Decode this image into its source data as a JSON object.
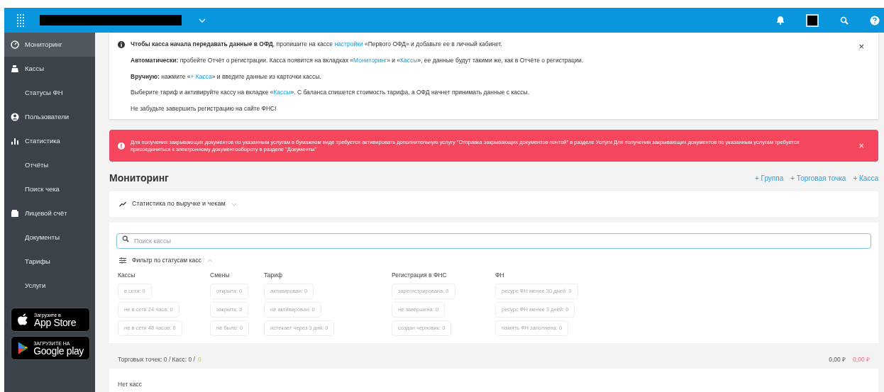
{
  "sidebar": {
    "items": [
      {
        "label": "Мониторинг",
        "kind": "gauge",
        "selected": true
      },
      {
        "label": "Кассы",
        "kind": "register",
        "selected": false
      },
      {
        "label": "Статусы ФН",
        "kind": "plain",
        "selected": false
      },
      {
        "label": "Пользователи",
        "kind": "user",
        "selected": false
      },
      {
        "label": "Статистика",
        "kind": "chart",
        "selected": false
      },
      {
        "label": "Отчёты",
        "kind": "plain",
        "selected": false
      },
      {
        "label": "Поиск чека",
        "kind": "plain",
        "selected": false
      },
      {
        "label": "Лицевой счёт",
        "kind": "wallet",
        "selected": false
      },
      {
        "label": "Документы",
        "kind": "plain",
        "selected": false
      },
      {
        "label": "Тарифы",
        "kind": "plain",
        "selected": false
      },
      {
        "label": "Услуги",
        "kind": "plain",
        "selected": false
      }
    ],
    "stores": [
      {
        "kind": "apple",
        "caption": "Загрузите в",
        "name": "App Store"
      },
      {
        "kind": "google",
        "caption": "ЗАГРУЗИТЕ НА",
        "name": "Google play"
      }
    ]
  },
  "info_notice": {
    "lines": [
      [
        {
          "kind": "bold",
          "text": "Чтобы касса начала передавать данные в ОФД"
        },
        {
          "kind": "text",
          "text": ", пропишите на кассе "
        },
        {
          "kind": "link",
          "text": "настройки"
        },
        {
          "kind": "text",
          "text": " «Первого ОФД» и добавьте ее в личный кабинет."
        }
      ],
      [
        {
          "kind": "bold",
          "text": "Автоматически:"
        },
        {
          "kind": "text",
          "text": " пробейте Отчёт о регистрации. Касса появится на вкладках «"
        },
        {
          "kind": "link",
          "text": "Мониторинг"
        },
        {
          "kind": "text",
          "text": "» и «"
        },
        {
          "kind": "link",
          "text": "Кассы"
        },
        {
          "kind": "text",
          "text": "», ее данные будут такими же, как в Отчёте о регистрации."
        }
      ],
      [
        {
          "kind": "bold",
          "text": "Вручную:"
        },
        {
          "kind": "text",
          "text": " нажмите «"
        },
        {
          "kind": "link",
          "text": "+ Касса"
        },
        {
          "kind": "text",
          "text": "» и введите данные из карточки кассы."
        }
      ],
      [
        {
          "kind": "text",
          "text": "Выберите тариф и активируйте кассу на вкладке «"
        },
        {
          "kind": "link",
          "text": "Кассы"
        },
        {
          "kind": "text",
          "text": "». С баланса спишется стоимость тарифа, а ОФД начнет принимать данные с кассы."
        }
      ],
      [
        {
          "kind": "text",
          "text": "Не забудьте завершить регистрацию на сайте ФНС!"
        }
      ]
    ],
    "close": "×"
  },
  "alert": {
    "text": "Для получения закрывающих документов по указанным услугам в бумажном виде требуется активировать дополнительную услугу \"Отправка закрывающих документов почтой\" в разделе Услуги Для получения закрывающих документов по указанным услугам требуется присоединиться к электронному документообороту в разделе \"Документы\"",
    "close": "×"
  },
  "page": {
    "title": "Мониторинг",
    "actions": [
      "+ Группа",
      "+ Торговая точка",
      "+ Касса"
    ]
  },
  "stats_toggle": {
    "label": "Статистика по выручке и чекам",
    "expanded": false
  },
  "search": {
    "placeholder": "Поиск кассы"
  },
  "filter": {
    "label": "Фильтр по статусам касс",
    "expanded": true,
    "groups": [
      {
        "title": "Кассы",
        "chips": [
          "в сети: 0",
          "не в сети 24 часа: 0",
          "не в сети 48 часов: 0"
        ]
      },
      {
        "title": "Смены",
        "chips": [
          "открыта: 0",
          "закрыта: 0",
          "не было: 0"
        ]
      },
      {
        "title": "Тариф",
        "chips": [
          "активирован: 0",
          "не активирован: 0",
          "истекает через 3 дня: 0"
        ]
      },
      {
        "title": "Регистрация в ФНС",
        "chips": [
          "зарегистрирована: 0",
          "не завершена: 0",
          "создан черновик: 0"
        ]
      },
      {
        "title": "ФН",
        "chips": [
          "ресурс ФН менее 30 дней: 0",
          "ресурс ФН менее 3 дней: 0",
          "память ФН заполнена: 0"
        ]
      }
    ]
  },
  "summary": {
    "text": "Торговых точек: 0 / Касс: 0 /",
    "count": "0",
    "balance": "0,00 ₽",
    "debt": "0,00 ₽"
  },
  "empty": "Нет касс"
}
